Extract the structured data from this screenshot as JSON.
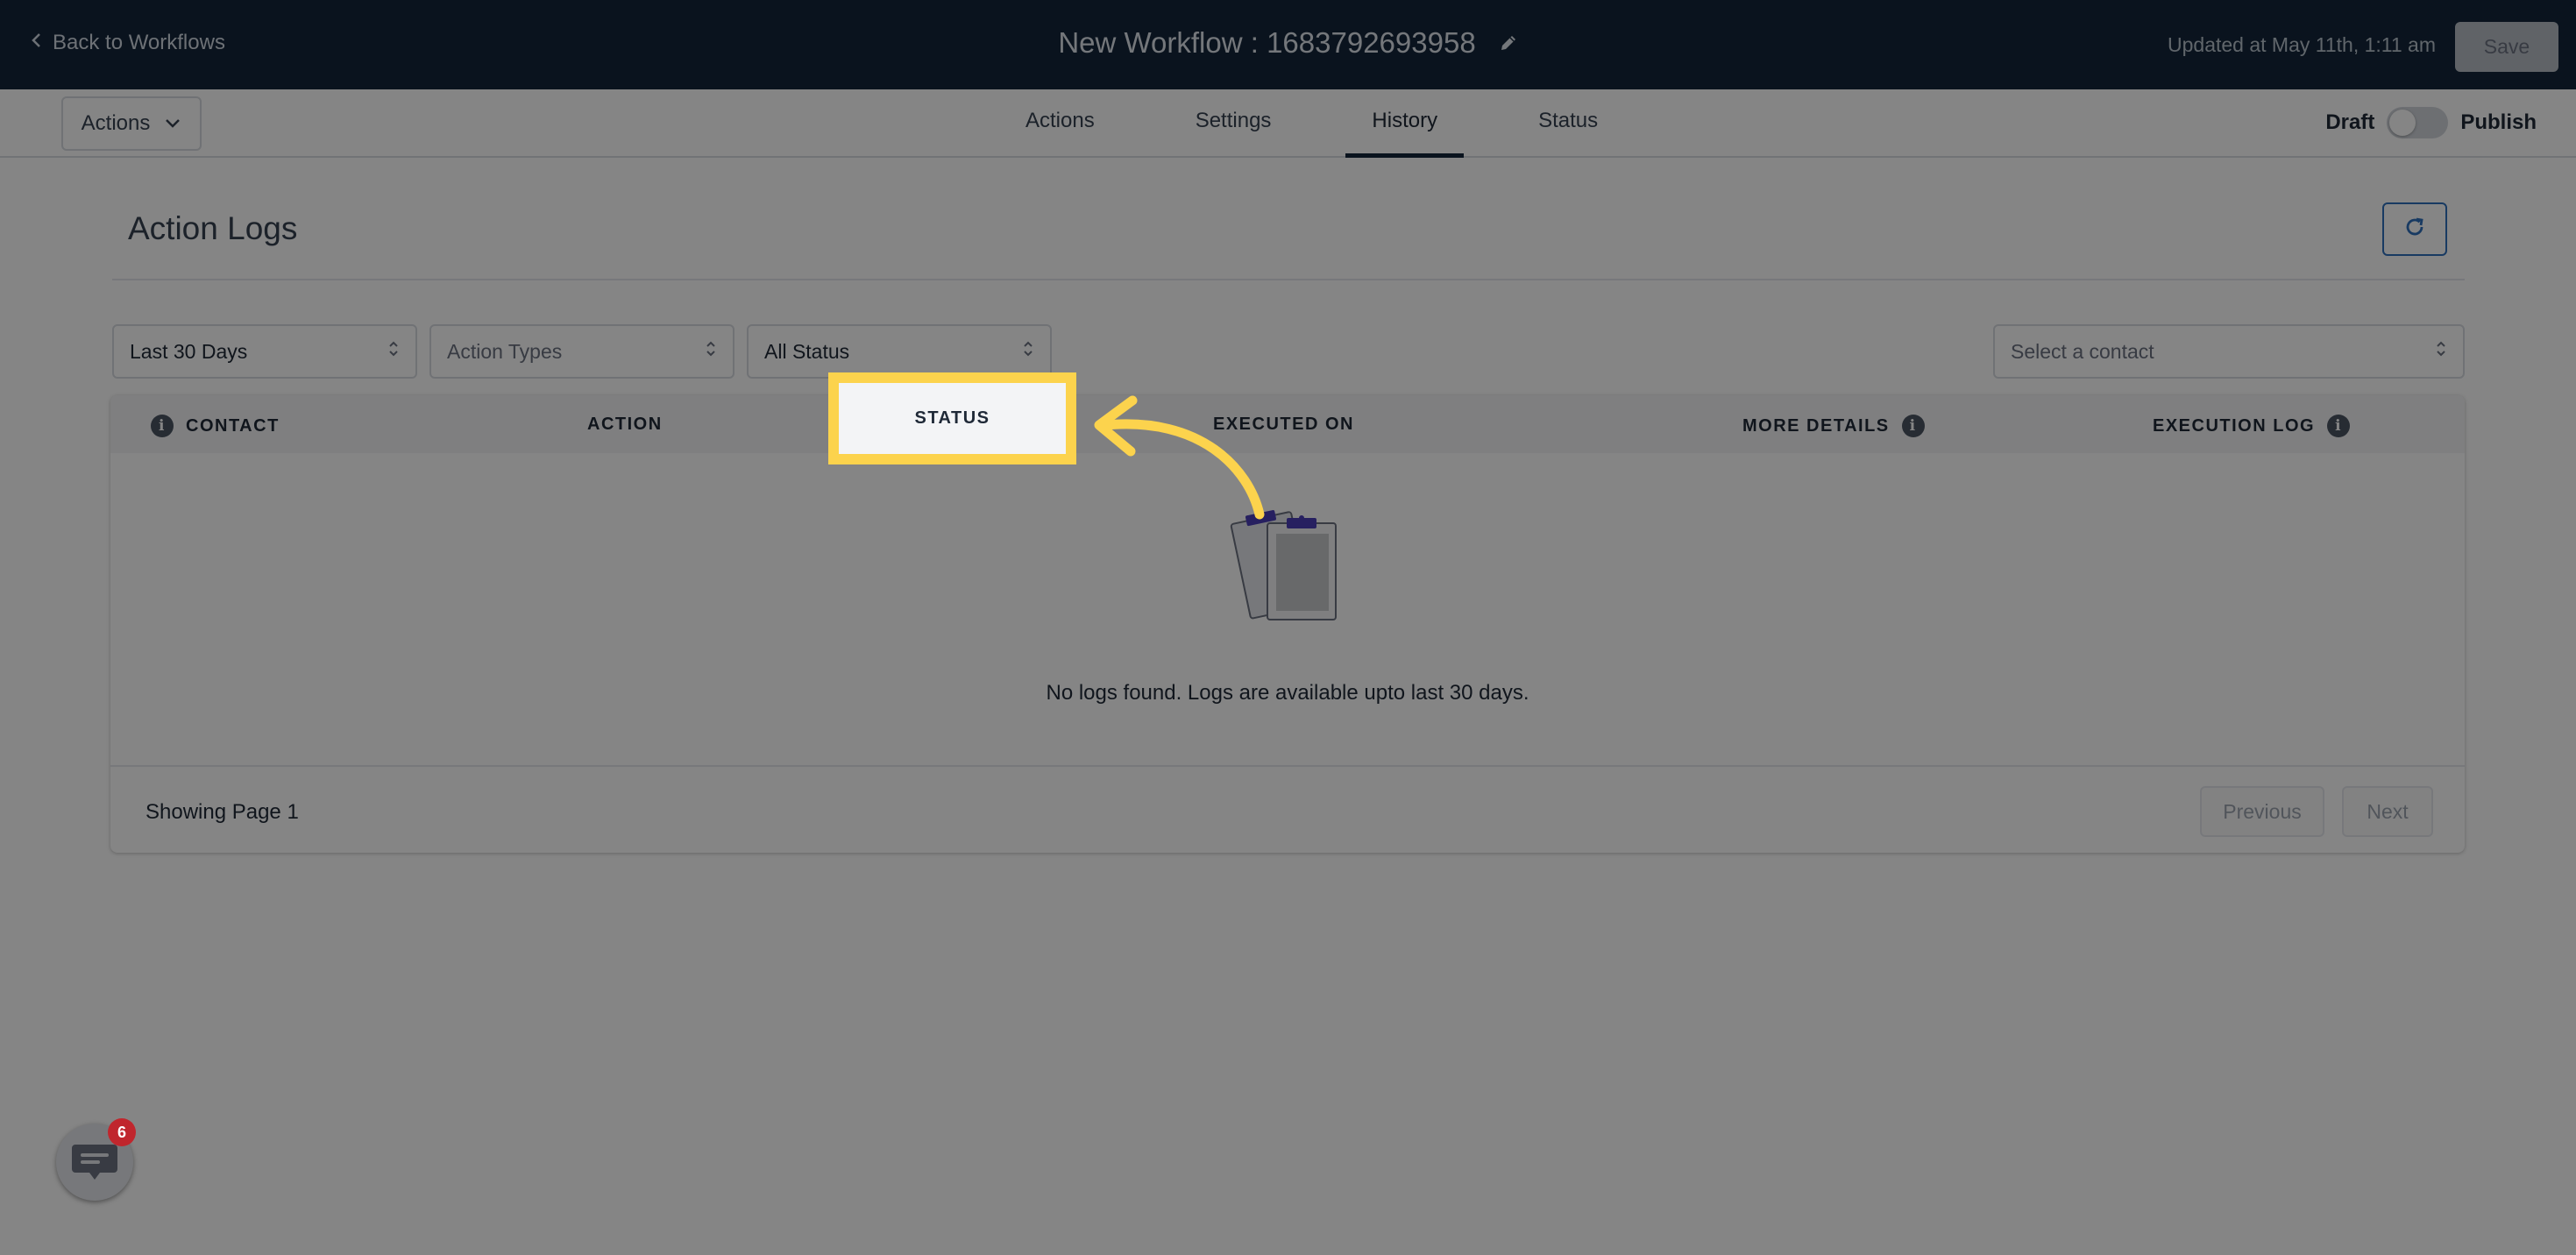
{
  "header": {
    "back_label": "Back to Workflows",
    "workflow_title": "New Workflow : 1683792693958",
    "updated_text": "Updated at May 11th, 1:11 am",
    "save_label": "Save"
  },
  "subnav": {
    "actions_dropdown": "Actions",
    "tabs": [
      {
        "label": "Actions"
      },
      {
        "label": "Settings"
      },
      {
        "label": "History",
        "active": true
      },
      {
        "label": "Status"
      }
    ],
    "draft_label": "Draft",
    "publish_label": "Publish",
    "published": false
  },
  "main": {
    "title": "Action Logs",
    "filters": {
      "date_range": "Last 30 Days",
      "action_types_placeholder": "Action Types",
      "status": "All Status",
      "contact_placeholder": "Select a contact"
    },
    "columns": {
      "contact": "CONTACT",
      "action": "ACTION",
      "status": "STATUS",
      "executed_on": "EXECUTED ON",
      "more_details": "MORE DETAILS",
      "execution_log": "EXECUTION LOG"
    },
    "empty_message": "No logs found. Logs are available upto last 30 days.",
    "pagination": {
      "showing": "Showing Page 1",
      "previous": "Previous",
      "next": "Next"
    }
  },
  "chat": {
    "badge_count": "6"
  },
  "colors": {
    "header_bg": "#15263a",
    "highlight": "#fcd34d",
    "accent_blue": "#2f6fbd",
    "badge_red": "#c0262d"
  },
  "info_glyph": "i"
}
